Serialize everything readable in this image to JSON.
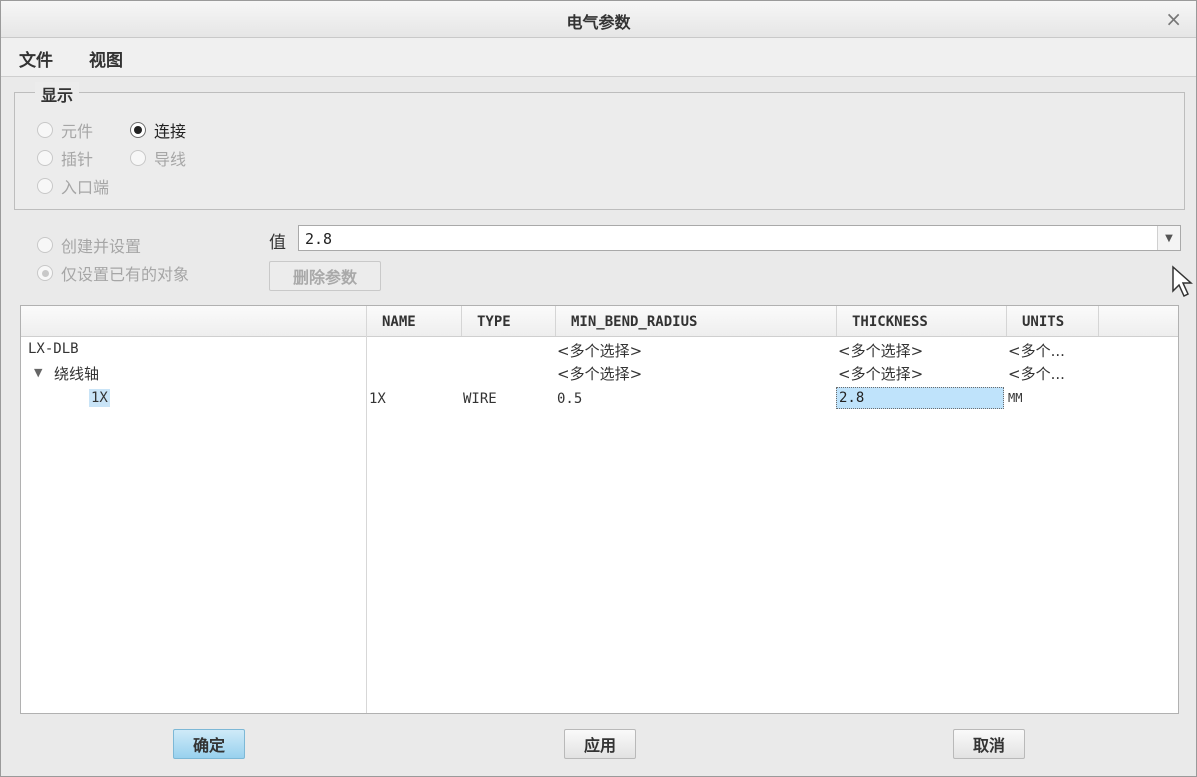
{
  "window": {
    "title": "电气参数",
    "close_glyph": "×"
  },
  "menu": [
    {
      "label": "文件"
    },
    {
      "label": "视图"
    }
  ],
  "display_group": {
    "title": "显示",
    "options": [
      {
        "label": "元件",
        "selected": false,
        "enabled": false
      },
      {
        "label": "连接",
        "selected": true,
        "enabled": true
      },
      {
        "label": "插针",
        "selected": false,
        "enabled": false
      },
      {
        "label": "导线",
        "selected": false,
        "enabled": false
      },
      {
        "label": "入口端",
        "selected": false,
        "enabled": false
      }
    ]
  },
  "mode_options": [
    {
      "label": "创建并设置",
      "selected": false,
      "enabled": false
    },
    {
      "label": "仅设置已有的对象",
      "selected": true,
      "enabled": false
    }
  ],
  "value_field": {
    "label": "值",
    "value": "2.8",
    "dropdown_icon": "▼"
  },
  "delete_button": {
    "label": "删除参数",
    "enabled": false
  },
  "table": {
    "columns": [
      "NAME",
      "TYPE",
      "MIN_BEND_RADIUS",
      "THICKNESS",
      "UNITS"
    ],
    "rows": [
      {
        "tree": "LX-DLB",
        "NAME": "",
        "TYPE": "",
        "MIN_BEND_RADIUS": "<多个选择>",
        "THICKNESS": "<多个选择>",
        "UNITS": "<多个..."
      },
      {
        "tree": "绕线轴",
        "expander": "▼",
        "NAME": "",
        "TYPE": "",
        "MIN_BEND_RADIUS": "<多个选择>",
        "THICKNESS": "<多个选择>",
        "UNITS": "<多个..."
      },
      {
        "tree": "1X",
        "NAME": "1X",
        "TYPE": "WIRE",
        "MIN_BEND_RADIUS": "0.5",
        "THICKNESS": "2.8",
        "UNITS": "MM"
      }
    ]
  },
  "buttons": {
    "ok": "确定",
    "apply": "应用",
    "cancel": "取消"
  },
  "colors": {
    "selection": "#c9e4f7",
    "primary_button": "#98d1ee",
    "edit_cell": "#bfe3fb"
  }
}
